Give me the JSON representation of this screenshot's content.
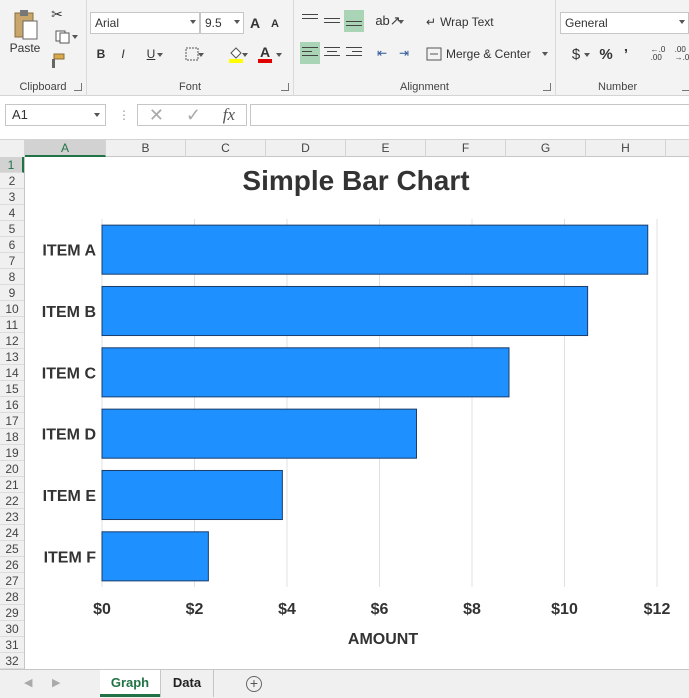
{
  "ribbon": {
    "clipboard": {
      "label": "Clipboard",
      "paste": "Paste"
    },
    "font": {
      "label": "Font",
      "family": "Arial",
      "size": "9.5",
      "bold": "B",
      "italic": "I",
      "underline": "U",
      "grow": "A",
      "shrink": "A",
      "font_color": "A"
    },
    "alignment": {
      "label": "Alignment",
      "wrap_text": "Wrap Text",
      "merge_center": "Merge & Center"
    },
    "number": {
      "label": "Number",
      "format": "General",
      "currency": "$",
      "percent": "%",
      "comma": "’",
      "dec_inc": "←.0\n.00",
      "dec_dec": ".00\n→.0"
    }
  },
  "formula_bar": {
    "name_box": "A1",
    "fx": "fx",
    "formula": ""
  },
  "columns": [
    "A",
    "B",
    "C",
    "D",
    "E",
    "F",
    "G",
    "H"
  ],
  "rows": [
    "1",
    "2",
    "3",
    "4",
    "5",
    "6",
    "7",
    "8",
    "9",
    "10",
    "11",
    "12",
    "13",
    "14",
    "15",
    "16",
    "17",
    "18",
    "19",
    "20",
    "21",
    "22",
    "23",
    "24",
    "25",
    "26",
    "27",
    "28",
    "29",
    "30",
    "31",
    "32"
  ],
  "active_cell": "A1",
  "sheet_tabs": [
    {
      "label": "Graph",
      "active": true
    },
    {
      "label": "Data",
      "active": false
    }
  ],
  "colors": {
    "bar": "#1e90ff",
    "bar_border": "#1a3d6d",
    "accent": "#217346",
    "grid": "#e0e0e0"
  },
  "chart_data": {
    "type": "bar",
    "orientation": "horizontal",
    "title": "Simple Bar Chart",
    "categories": [
      "ITEM A",
      "ITEM B",
      "ITEM C",
      "ITEM D",
      "ITEM E",
      "ITEM F"
    ],
    "values": [
      11.8,
      10.5,
      8.8,
      6.8,
      3.9,
      2.3
    ],
    "xlabel": "AMOUNT",
    "ylabel": "",
    "xlim": [
      0,
      12
    ],
    "xticks": [
      "$0",
      "$2",
      "$4",
      "$6",
      "$8",
      "$10",
      "$12"
    ],
    "grid": true
  }
}
